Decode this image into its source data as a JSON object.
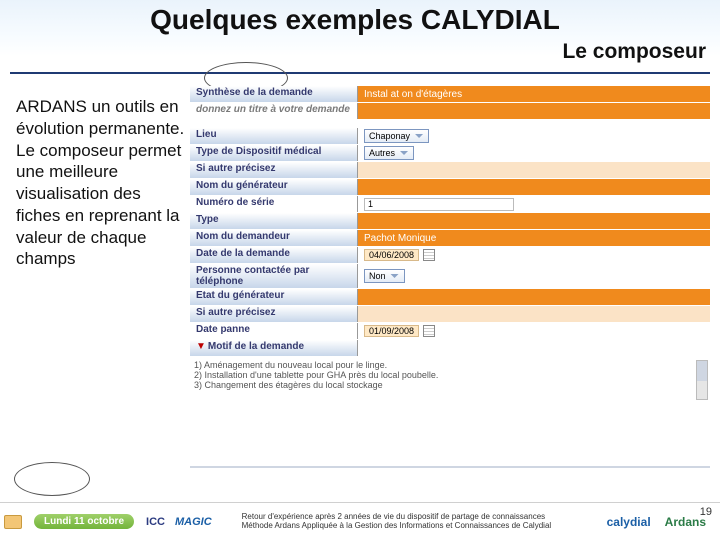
{
  "title": "Quelques exemples CALYDIAL",
  "subtitle": "Le composeur",
  "body_text": "ARDANS un outils en évolution permanente. Le composeur permet une meilleure visualisation des fiches en reprenant la valeur de chaque champs",
  "form": {
    "synthese_label": "Synthèse de la demande",
    "synthese_value": "Instal at on d'étagères",
    "synthese_hint": "donnez un titre à votre demande",
    "lieu_label": "Lieu",
    "lieu_value": "Chaponay",
    "typedisp_label": "Type de Dispositif médical",
    "typedisp_value": "Autres",
    "siautre_label": "Si autre précisez",
    "nomgen_label": "Nom du générateur",
    "numserie_label": "Numéro de série",
    "numserie_value": "1",
    "type_label": "Type",
    "nomdem_label": "Nom du demandeur",
    "nomdem_value": "Pachot Monique",
    "datedem_label": "Date de la demande",
    "datedem_value": "04/06/2008",
    "contact_label": "Personne contactée par téléphone",
    "contact_value": "Non",
    "etat_label": "Etat du générateur",
    "siautre2_label": "Si autre précisez",
    "panne_label": "Date panne",
    "panne_value": "01/09/2008",
    "motif_label": "Motif de la demande",
    "list": {
      "l1": "1) Aménagement du nouveau local pour le linge.",
      "l2": "2) Installation d'une tablette pour GHA près du local poubelle.",
      "l3": "3) Changement des étagères du local stockage"
    }
  },
  "footer": {
    "date": "Lundi 11 octobre",
    "logo_icc": "ICC",
    "logo_magic": "MAGIC",
    "text_line1": "Retour d'expérience après 2 années de vie du dispositif de partage de connaissances",
    "text_line2": "Méthode Ardans Appliquée à la Gestion des Informations et Connaissances de Calydial",
    "logo_calydial": "calydial",
    "logo_ardans": "Ardans",
    "slide_num": "19"
  }
}
